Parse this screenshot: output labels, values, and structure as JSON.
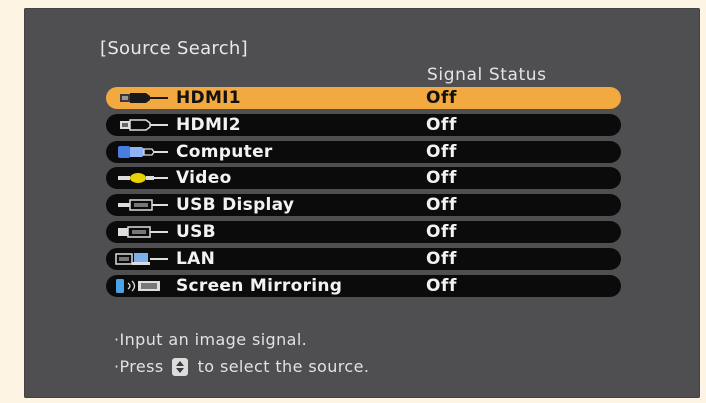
{
  "menu": {
    "title": "[Source Search]",
    "column_header": "Signal Status"
  },
  "sources": [
    {
      "name": "HDMI1",
      "status": "Off",
      "icon": "hdmi-icon",
      "selected": true
    },
    {
      "name": "HDMI2",
      "status": "Off",
      "icon": "hdmi-icon",
      "selected": false
    },
    {
      "name": "Computer",
      "status": "Off",
      "icon": "vga-computer-icon",
      "selected": false
    },
    {
      "name": "Video",
      "status": "Off",
      "icon": "rca-video-icon",
      "selected": false
    },
    {
      "name": "USB Display",
      "status": "Off",
      "icon": "usb-display-icon",
      "selected": false
    },
    {
      "name": "USB",
      "status": "Off",
      "icon": "usb-icon",
      "selected": false
    },
    {
      "name": "LAN",
      "status": "Off",
      "icon": "lan-icon",
      "selected": false
    },
    {
      "name": "Screen Mirroring",
      "status": "Off",
      "icon": "screen-mirroring-icon",
      "selected": false
    }
  ],
  "help": {
    "line1": "·Input an image signal.",
    "line2_before": "·Press",
    "line2_after": "to select the source."
  },
  "colors": {
    "background": "#fdf4e4",
    "panel": "#4f4f51",
    "row": "#0b0b0b",
    "highlight": "#f2a93f"
  }
}
